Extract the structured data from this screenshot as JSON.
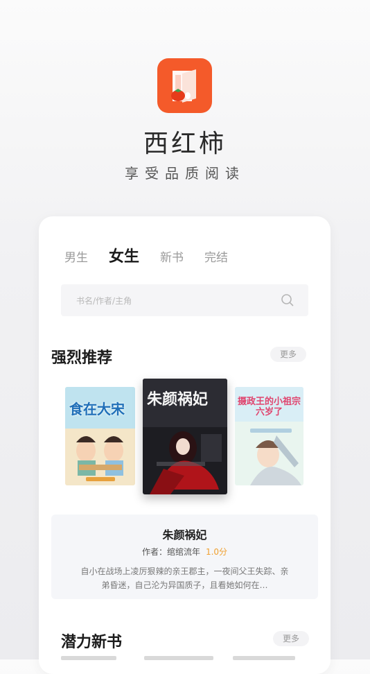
{
  "app": {
    "name": "西红柿",
    "slogan": "享受品质阅读",
    "brand_color": "#f45a2a",
    "icon": "book-tomato-icon"
  },
  "tabs": [
    {
      "label": "男生",
      "active": false
    },
    {
      "label": "女生",
      "active": true
    },
    {
      "label": "新书",
      "active": false
    },
    {
      "label": "完结",
      "active": false
    }
  ],
  "search": {
    "placeholder": "书名/作者/主角",
    "icon": "search-icon"
  },
  "recommend": {
    "title": "强烈推荐",
    "more_label": "更多",
    "covers": [
      {
        "title": "食在大宋"
      },
      {
        "title": "朱颜祸妃"
      },
      {
        "title": "摄政王的小祖宗六岁了"
      }
    ],
    "selected": {
      "name": "朱颜祸妃",
      "author_label": "作者：",
      "author": "绾绾流年",
      "rating": "1.0分",
      "description": "自小在战场上凌厉狠辣的亲王郡主，一夜间父王失踪、亲弟昏迷，自己沦为异国质子，且看她如何在…"
    }
  },
  "potential": {
    "title": "潜力新书",
    "more_label": "更多"
  }
}
